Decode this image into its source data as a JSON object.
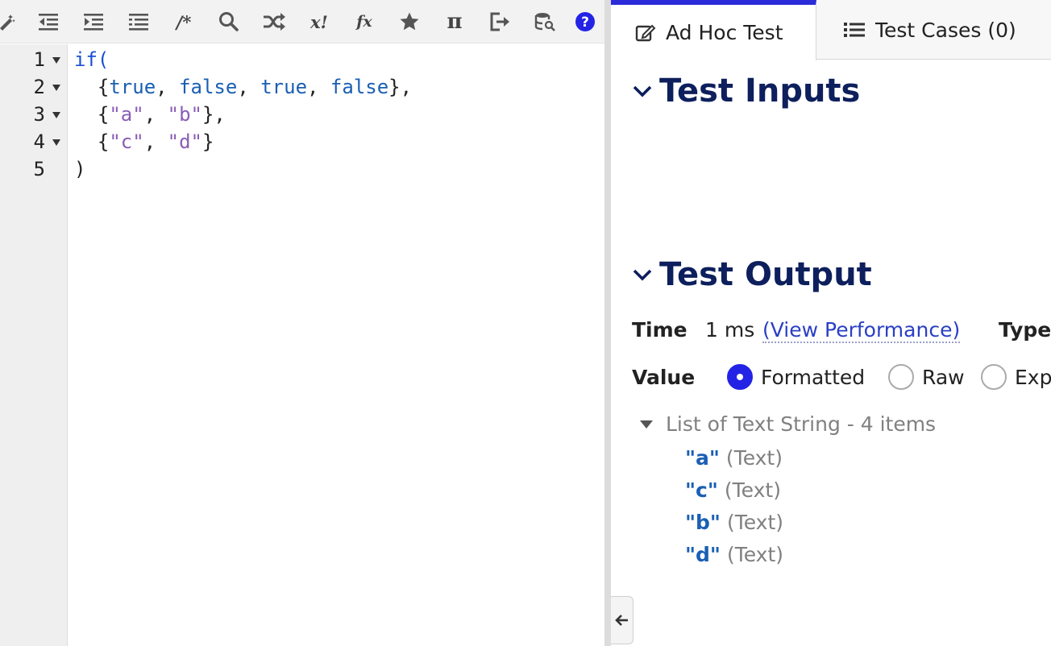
{
  "toolbar": {
    "buttons": [
      {
        "name": "format-icon"
      },
      {
        "name": "outdent-icon"
      },
      {
        "name": "indent-icon"
      },
      {
        "name": "list-icon"
      },
      {
        "name": "comment-icon",
        "label": "/*"
      },
      {
        "name": "search-icon"
      },
      {
        "name": "shuffle-icon"
      },
      {
        "name": "factorial-icon",
        "label": "x!"
      },
      {
        "name": "function-icon",
        "label": "fx"
      },
      {
        "name": "star-icon"
      },
      {
        "name": "pi-icon",
        "label": "π"
      },
      {
        "name": "export-icon"
      },
      {
        "name": "database-search-icon"
      },
      {
        "name": "help-icon",
        "label": "?"
      }
    ]
  },
  "editor": {
    "line_numbers": [
      "1",
      "2",
      "3",
      "4",
      "5"
    ],
    "lines": [
      [
        {
          "t": "kw",
          "v": "if("
        }
      ],
      [
        {
          "t": "p",
          "v": "  {"
        },
        {
          "t": "bool",
          "v": "true"
        },
        {
          "t": "p",
          "v": ", "
        },
        {
          "t": "bool",
          "v": "false"
        },
        {
          "t": "p",
          "v": ", "
        },
        {
          "t": "bool",
          "v": "true"
        },
        {
          "t": "p",
          "v": ", "
        },
        {
          "t": "bool",
          "v": "false"
        },
        {
          "t": "p",
          "v": "},"
        }
      ],
      [
        {
          "t": "p",
          "v": "  {"
        },
        {
          "t": "str",
          "v": "\"a\""
        },
        {
          "t": "p",
          "v": ", "
        },
        {
          "t": "str",
          "v": "\"b\""
        },
        {
          "t": "p",
          "v": "},"
        }
      ],
      [
        {
          "t": "p",
          "v": "  {"
        },
        {
          "t": "str",
          "v": "\"c\""
        },
        {
          "t": "p",
          "v": ", "
        },
        {
          "t": "str",
          "v": "\"d\""
        },
        {
          "t": "p",
          "v": "}"
        }
      ],
      [
        {
          "t": "p",
          "v": ")"
        }
      ]
    ]
  },
  "tabs": {
    "ad_hoc": "Ad Hoc Test",
    "test_cases": "Test Cases (0)"
  },
  "sections": {
    "inputs_title": "Test Inputs",
    "output_title": "Test Output"
  },
  "output": {
    "time_label": "Time",
    "time_value": "1 ms",
    "perf_link": "(View Performance)",
    "type_label": "Type",
    "value_label": "Value",
    "formats": [
      "Formatted",
      "Raw",
      "Exp"
    ],
    "selected_format": "Formatted",
    "result_summary": "List of Text String - 4 items",
    "items": [
      {
        "value": "\"a\"",
        "type": "(Text)"
      },
      {
        "value": "\"c\"",
        "type": "(Text)"
      },
      {
        "value": "\"b\"",
        "type": "(Text)"
      },
      {
        "value": "\"d\"",
        "type": "(Text)"
      }
    ]
  },
  "colors": {
    "accent": "#2b2bd9",
    "heading": "#0d1f5c",
    "keyword": "#1a4fd6",
    "string": "#8a5db5",
    "value": "#1a5fb4"
  }
}
